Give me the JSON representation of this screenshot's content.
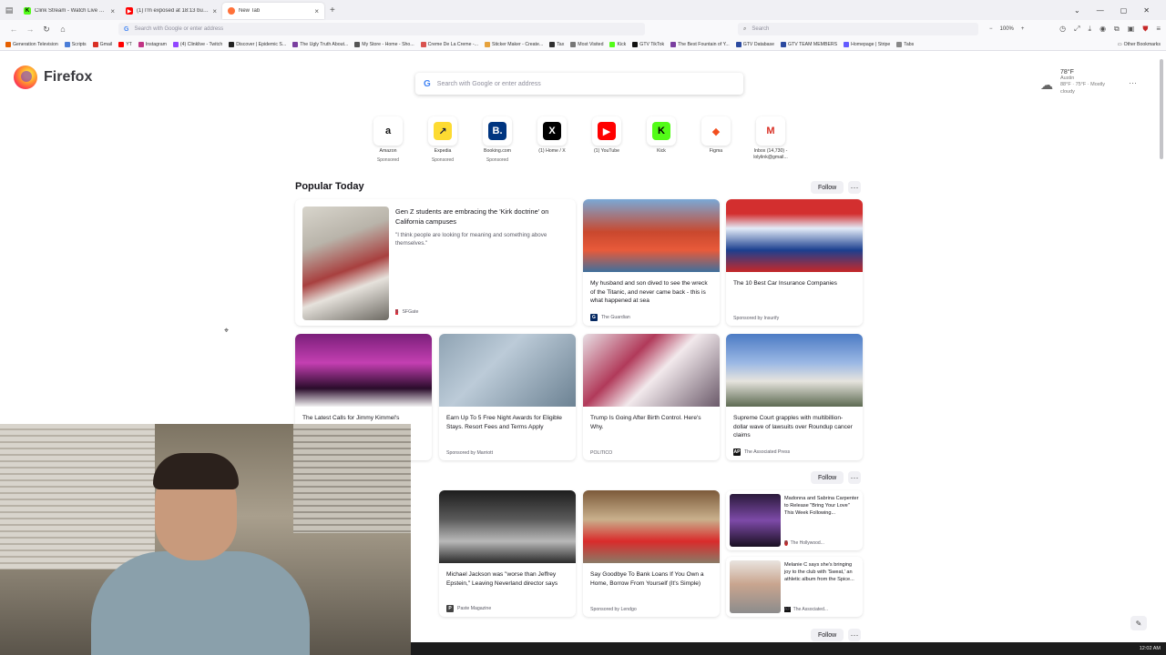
{
  "tabs": [
    {
      "title": "Clink Stream - Watch Live on Ki...",
      "color": "#53fc18",
      "active": false
    },
    {
      "title": "(1) I'm exposed at 18:13 but app...",
      "color": "#ff0000",
      "active": false
    },
    {
      "title": "New Tab",
      "color": "#ff7139",
      "active": true
    }
  ],
  "navbar": {
    "url_placeholder": "Search with Google or enter address",
    "search_placeholder": "Search",
    "zoom": "100%"
  },
  "bookmarks": [
    {
      "label": "Generation Television",
      "color": "#e66000"
    },
    {
      "label": "Scripts",
      "color": "#4a7dd8"
    },
    {
      "label": "Gmail",
      "color": "#d93025"
    },
    {
      "label": "YT",
      "color": "#ff0000"
    },
    {
      "label": "Instagram",
      "color": "#c13584"
    },
    {
      "label": "(4) Clinklive - Twitch",
      "color": "#9146ff"
    },
    {
      "label": "Discover | Epidemic S...",
      "color": "#222222"
    },
    {
      "label": "The Ugly Truth About...",
      "color": "#7a3fa0"
    },
    {
      "label": "My Store - Home - Sho...",
      "color": "#555555"
    },
    {
      "label": "Creme De La Creme -...",
      "color": "#d9534f"
    },
    {
      "label": "Sticker Maker - Create...",
      "color": "#e6a23c"
    },
    {
      "label": "Tax",
      "color": "#2f2f2f"
    },
    {
      "label": "Most Visited",
      "color": "#777777"
    },
    {
      "label": "Kick",
      "color": "#53fc18"
    },
    {
      "label": "GTV TikTok",
      "color": "#111111"
    },
    {
      "label": "The Best Fountain of Y...",
      "color": "#7a3fa0"
    },
    {
      "label": "GTV Database",
      "color": "#2b4aa0"
    },
    {
      "label": "GTV TEAM MEMBERS",
      "color": "#2b4aa0"
    },
    {
      "label": "Homepage | Stripe",
      "color": "#635bff"
    },
    {
      "label": "Tabs",
      "color": "#888888"
    }
  ],
  "other_bookmarks": "Other Bookmarks",
  "brand": "Firefox",
  "page_search_placeholder": "Search with Google or enter address",
  "weather": {
    "temp": "78°F",
    "location": "Austin",
    "range": "88°F · 75°F · Mostly",
    "condition": "cloudy"
  },
  "shortcuts": [
    {
      "label": "Amazon",
      "sub": "Sponsored",
      "glyph": "a",
      "bg": "#ffffff",
      "fg": "#111111"
    },
    {
      "label": "Expedia",
      "sub": "Sponsored",
      "glyph": "↗",
      "bg": "#fddb32",
      "fg": "#191e3b"
    },
    {
      "label": "Booking.com",
      "sub": "Sponsored",
      "glyph": "B.",
      "bg": "#003580",
      "fg": "#ffffff"
    },
    {
      "label": "(1) Home / X",
      "sub": "",
      "glyph": "X",
      "bg": "#000000",
      "fg": "#ffffff"
    },
    {
      "label": "(1) YouTube",
      "sub": "",
      "glyph": "▶",
      "bg": "#ff0000",
      "fg": "#ffffff"
    },
    {
      "label": "Kick",
      "sub": "",
      "glyph": "K",
      "bg": "#53fc18",
      "fg": "#000000"
    },
    {
      "label": "Figma",
      "sub": "",
      "glyph": "◆",
      "bg": "#ffffff",
      "fg": "#f24e1e"
    },
    {
      "label": "Inbox (14,730) - lolylink@gmail...",
      "sub": "",
      "glyph": "M",
      "bg": "#ffffff",
      "fg": "#d93025"
    }
  ],
  "popular": {
    "title": "Popular Today",
    "follow": "Follow",
    "feature": {
      "title": "Gen Z students are embracing the 'Kirk doctrine' on California campuses",
      "excerpt": "\"I think people are looking for meaning and something above themselves.\"",
      "source": "SFGate"
    },
    "cards": [
      {
        "title": "My husband and son dived to see the wreck of the Titanic, and never came back - this is what happened at sea",
        "source": "The Guardian",
        "img": "linear-gradient(180deg,#7aa8d6 0%,#c9482e 45%,#e85a3a 70%,#3f6f9c 100%)"
      },
      {
        "title": "The 10 Best Car Insurance Companies",
        "source": "Sponsored by Insurify",
        "img": "linear-gradient(180deg,#d32f2f 0%,#d32f2f 20%,#e3ecf8 40%,#1c3f8f 70%,#c62828 100%)"
      },
      {
        "title": "The Latest Calls for Jimmy Kimmel's",
        "source": "",
        "img": "linear-gradient(180deg,#7b1f7a 0%,#c43fb2 40%,#2a0c2b 75%,#f2f2f2 100%)"
      },
      {
        "title": "Earn Up To 5 Free Night Awards for Eligible Stays. Resort Fees and Terms Apply",
        "source": "Sponsored by Marriott",
        "img": "linear-gradient(135deg,#8fa3b3 0%,#bccbd8 40%,#6c8293 100%)"
      },
      {
        "title": "Trump Is Going After Birth Control. Here's Why.",
        "source": "POLITICO",
        "img": "linear-gradient(135deg,#e8dfe4 0%,#b13a5a 35%,#f2e9ec 55%,#6b5a6a 100%)"
      },
      {
        "title": "Supreme Court grapples with multibillion-dollar wave of lawsuits over Roundup cancer claims",
        "source": "The Associated Press",
        "img": "linear-gradient(180deg,#4c7bc4 0%,#9bb8e4 40%,#e6e4de 65%,#5d6a52 100%)"
      }
    ]
  },
  "second": {
    "follow": "Follow",
    "cards": [
      {
        "title": "Michael Jackson was \"worse than Jeffrey Epstein,\" Leaving Neverland director says",
        "source": "Paste Magazine",
        "img": "linear-gradient(180deg,#1d1d1d 0%,#5a5a5a 40%,#b9b9b9 70%,#2a2a2a 100%)"
      },
      {
        "title": "Say Goodbye To Bank Loans If You Own a Home, Borrow From Yourself (It's Simple)",
        "source": "Sponsored by Lendgo",
        "img": "linear-gradient(180deg,#7c5a3a 0%,#c9b08c 40%,#d92b2b 70%,#8a7a66 100%)"
      }
    ],
    "minis": [
      {
        "title": "Madonna and Sabrina Carpenter to Release \"Bring Your Love\" This Week Following...",
        "source": "The Hollywood...",
        "img": "linear-gradient(180deg,#2b1a3b 0%,#7d4aa8 50%,#1a1022 100%)"
      },
      {
        "title": "Melanie C says she's bringing joy to the club with 'Sweat,' an athletic album from the Spice...",
        "source": "The Associated...",
        "img": "linear-gradient(180deg,#e9e4df 0%,#c9a58f 45%,#8c8c8c 100%)"
      }
    ]
  },
  "third_follow": "Follow",
  "clock": "12:02 AM"
}
